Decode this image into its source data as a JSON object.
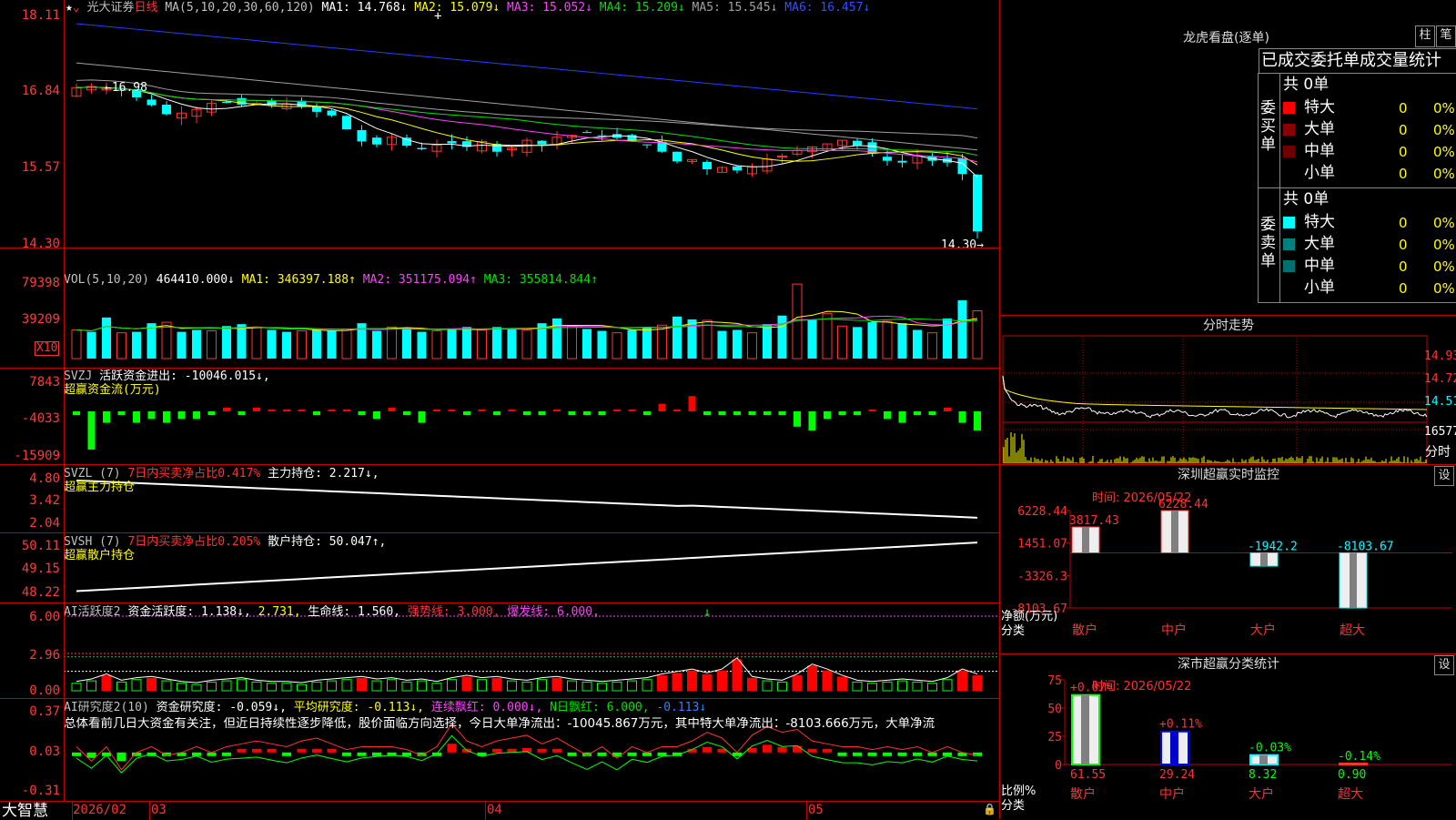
{
  "colors": {
    "up": "#ff3232",
    "down": "#00ffff",
    "green": "#00e000",
    "yellow": "#ffff00",
    "magenta": "#ff40ff",
    "grid": "#c00000",
    "white": "#ffffff"
  },
  "main": {
    "stock_name": "光大证券",
    "period": "日线",
    "ma_legend": {
      "params": "MA(5,10,20,30,60,120)",
      "ma1": "MA1: 14.768↓",
      "ma2": "MA2: 15.079↓",
      "ma3": "MA3: 15.052↓",
      "ma4": "MA4: 15.209↓",
      "ma5": "MA5: 15.545↓",
      "ma6": "MA6: 16.457↓"
    },
    "y_ticks": [
      "18.11",
      "16.84",
      "15.57",
      "14.30"
    ],
    "high_label": "16.98",
    "low_label": "14.30"
  },
  "vol": {
    "legend": {
      "params": "VOL(5,10,20)",
      "val": "464410.000↓",
      "ma1": "MA1: 346397.188↑",
      "ma2": "MA2: 351175.094↑",
      "ma3": "MA3: 355814.844↑"
    },
    "y_ticks": [
      "79398",
      "39209"
    ],
    "unit": "X10"
  },
  "svzj": {
    "legend": {
      "name": "SVZJ",
      "desc": "活跃资金进出: -10046.015↓,",
      "title": "超赢资金流(万元)"
    },
    "y_ticks": [
      "7843",
      "-4033",
      "-15909"
    ]
  },
  "svzl": {
    "legend": {
      "name": "SVZL (7)",
      "desc": "7日内买卖净占比0.417%",
      "val": "主力持仓: 2.217↓,",
      "title": "超赢主力持仓"
    },
    "y_ticks": [
      "4.80",
      "3.42",
      "2.04"
    ]
  },
  "svsh": {
    "legend": {
      "name": "SVSH (7)",
      "desc": "7日内买卖净占比0.205%",
      "val": "散户持仓: 50.047↑,",
      "title": "超赢散户持仓"
    },
    "y_ticks": [
      "50.11",
      "49.15",
      "48.22"
    ]
  },
  "ai2": {
    "legend": {
      "name": "AI活跃度2",
      "a": "资金活跃度: 1.138↓,",
      "b": "2.731,",
      "c": "生命线: 1.560,",
      "d": "强势线: 3.000,",
      "e": "爆发线: 6.000,"
    },
    "y_ticks": [
      "6.00",
      "2.96",
      "0.00"
    ]
  },
  "ai_research": {
    "legend": {
      "name": "AI研究度2(10)",
      "a": "资金研究度: -0.059↓,",
      "b": "平均研究度: -0.113↓,",
      "c": "连续飘红: 0.000↓,",
      "d": "N日飘红: 6.000,",
      "e": "-0.113↓"
    },
    "summary": "总体看前几日大资金有关注，但近日持续性逐步降低，股价面临方向选择，今日大单净流出：-10045.867万元，其中特大单净流出：-8103.666万元，大单净流",
    "y_ticks": [
      "0.37",
      "0.03",
      "-0.31"
    ]
  },
  "bottom": {
    "brand": "大智慧",
    "dates": [
      "2026/02",
      "03",
      "04",
      "05"
    ]
  },
  "lhb": {
    "title": "龙虎看盘(逐单)",
    "btn1": "柱",
    "btn2": "笔",
    "tabs": "已成交委托单成交量统计",
    "buy": {
      "label": "委买单",
      "total": "共 0单",
      "rows": [
        {
          "n": "特大",
          "v": "0",
          "p": "0%",
          "c": "#ff0000"
        },
        {
          "n": "大单",
          "v": "0",
          "p": "0%",
          "c": "#8b0000"
        },
        {
          "n": "中单",
          "v": "0",
          "p": "0%",
          "c": "#700000"
        },
        {
          "n": "小单",
          "v": "0",
          "p": "0%",
          "c": ""
        }
      ]
    },
    "sell": {
      "label": "委卖单",
      "total": "共 0单",
      "rows": [
        {
          "n": "特大",
          "v": "0",
          "p": "0%",
          "c": "#00ffff"
        },
        {
          "n": "大单",
          "v": "0",
          "p": "0%",
          "c": "#008080"
        },
        {
          "n": "中单",
          "v": "0",
          "p": "0%",
          "c": "#007070"
        },
        {
          "n": "小单",
          "v": "0",
          "p": "0%",
          "c": ""
        }
      ]
    }
  },
  "fenshi": {
    "title": "分时走势",
    "y_ticks": [
      "14.93",
      "14.72",
      "14.51",
      "16577"
    ],
    "unit": "分时"
  },
  "szmon": {
    "title": "深圳超赢实时监控",
    "btn": "设",
    "time": "时间: 2026/05/22",
    "y_ticks": [
      "6228.44",
      "1451.07",
      "-3326.3",
      "-8103.67"
    ],
    "ylabel": "净额(万元)",
    "xlabel": "分类",
    "cats": [
      "散户",
      "中户",
      "大户",
      "超大"
    ],
    "values": [
      "3817.43",
      "6228.44",
      "-1942.2",
      "-8103.67"
    ],
    "nums": [
      3817.43,
      6228.44,
      -1942.2,
      -8103.67
    ]
  },
  "szcls": {
    "title": "深市超赢分类统计",
    "btn": "设",
    "time": "时间: 2026/05/22",
    "y_ticks": [
      "75",
      "50",
      "25",
      "0"
    ],
    "ylabel": "比例%",
    "xlabel": "分类",
    "cats": [
      "散户",
      "中户",
      "大户",
      "超大"
    ],
    "changes": [
      "+0.07%",
      "+0.11%",
      "-0.03%",
      "-0.14%"
    ],
    "values": [
      "61.55",
      "29.24",
      "8.32",
      "0.90"
    ],
    "nums": [
      61.55,
      29.24,
      8.32,
      0.9
    ]
  }
}
